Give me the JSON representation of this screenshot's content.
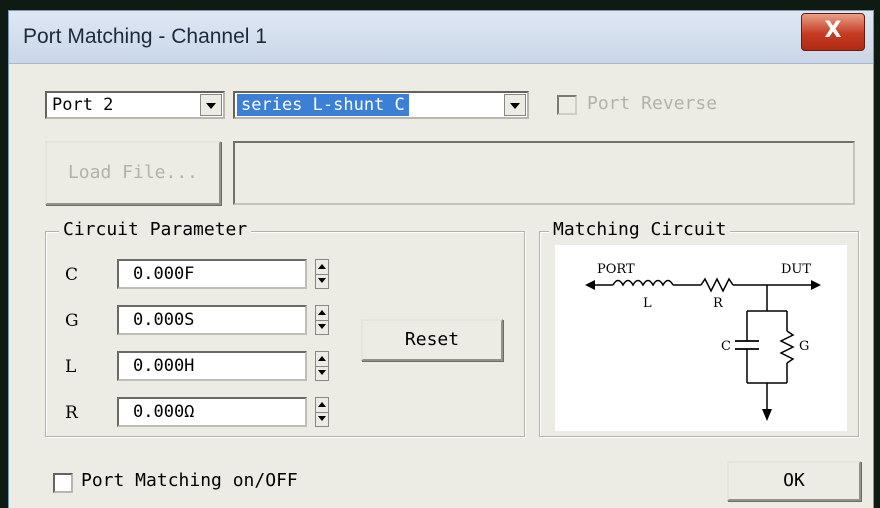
{
  "window": {
    "title": "Port Matching - Channel 1",
    "close_glyph": "X"
  },
  "port_select": {
    "value": "Port 2"
  },
  "topology_select": {
    "value": "series L-shunt C"
  },
  "port_reverse": {
    "label": "Port Reverse",
    "checked": false,
    "enabled": false
  },
  "load_file": {
    "label": "Load File...",
    "enabled": false,
    "path": ""
  },
  "circuit_parameter": {
    "title": "Circuit Parameter",
    "params": [
      {
        "name": "C",
        "value": "0.000F"
      },
      {
        "name": "G",
        "value": "0.000S"
      },
      {
        "name": "L",
        "value": "0.000H"
      },
      {
        "name": "R",
        "value": "0.000Ω"
      }
    ],
    "reset_label": "Reset"
  },
  "matching_circuit": {
    "title": "Matching Circuit",
    "labels": {
      "port": "PORT",
      "dut": "DUT",
      "l": "L",
      "r": "R",
      "c": "C",
      "g": "G"
    }
  },
  "port_matching_toggle": {
    "label": "Port Matching on/OFF",
    "checked": false
  },
  "ok_button": {
    "label": "OK"
  },
  "colors": {
    "selection": "#3c7fd6",
    "close_button": "#c63b22",
    "dialog_bg": "#ecebe4"
  }
}
